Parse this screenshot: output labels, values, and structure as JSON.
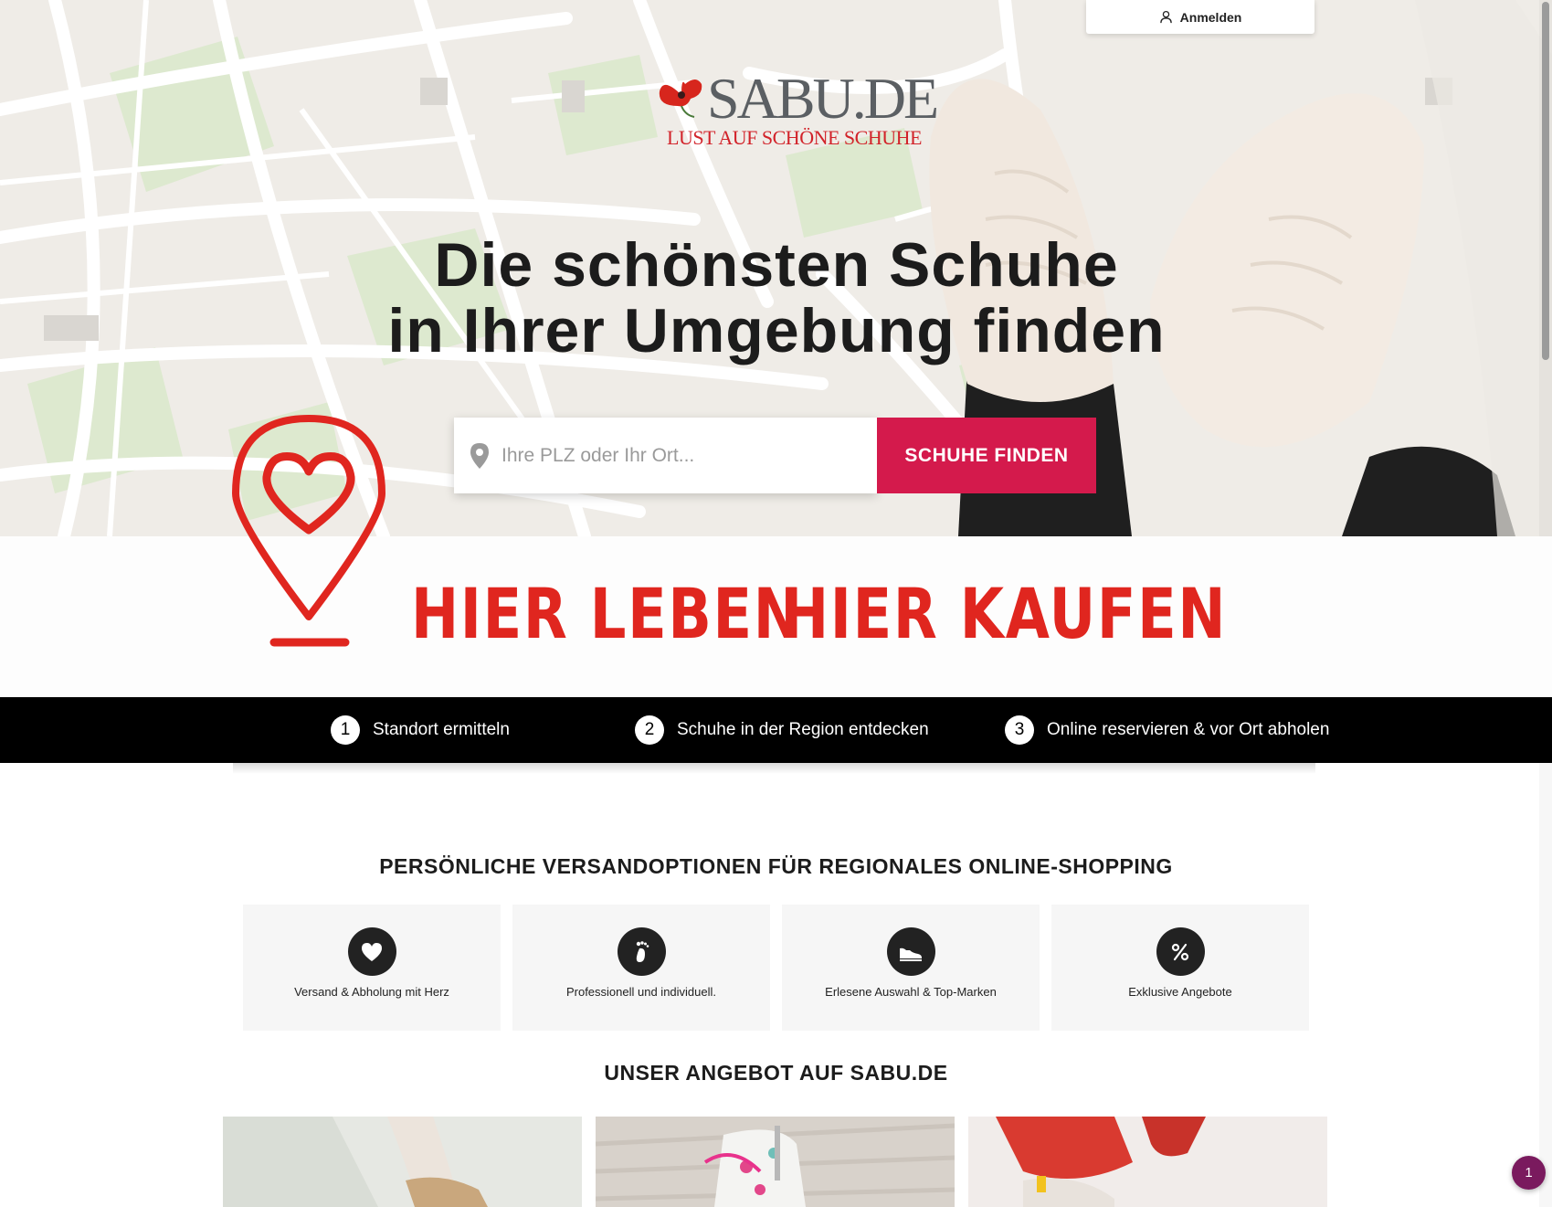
{
  "header": {
    "login_label": "Anmelden",
    "login_icon": "user-icon"
  },
  "logo": {
    "title": "SABU.DE",
    "tagline": "LUST AUF SCHÖNE SCHUHE"
  },
  "hero": {
    "headline_line1": "Die schönsten Schuhe",
    "headline_line2": "in Ihrer Umgebung finden",
    "search_placeholder": "Ihre PLZ oder Ihr Ort...",
    "search_value": "",
    "search_button": "SCHUHE FINDEN",
    "accent_color": "#d41a4c"
  },
  "banner": {
    "slogan_left": "HIER LEBEN",
    "slogan_right": "HIER KAUFEN",
    "color": "#e0261f"
  },
  "steps": [
    {
      "number": "1",
      "label": "Standort ermitteln"
    },
    {
      "number": "2",
      "label": "Schuhe in der Region entdecken"
    },
    {
      "number": "3",
      "label": "Online reservieren & vor Ort abholen"
    }
  ],
  "shipping": {
    "title": "PERSÖNLICHE VERSANDOPTIONEN FÜR REGIONALES ONLINE-SHOPPING",
    "cards": [
      {
        "icon": "heart-icon",
        "label": "Versand & Abholung mit Herz"
      },
      {
        "icon": "footprint-icon",
        "label": "Professionell und individuell."
      },
      {
        "icon": "sneaker-icon",
        "label": "Erlesene Auswahl & Top-Marken"
      },
      {
        "icon": "percent-icon",
        "label": "Exklusive Angebote"
      }
    ]
  },
  "offer": {
    "title": "UNSER ANGEBOT AUF SABU.DE"
  },
  "chat": {
    "badge": "1"
  }
}
